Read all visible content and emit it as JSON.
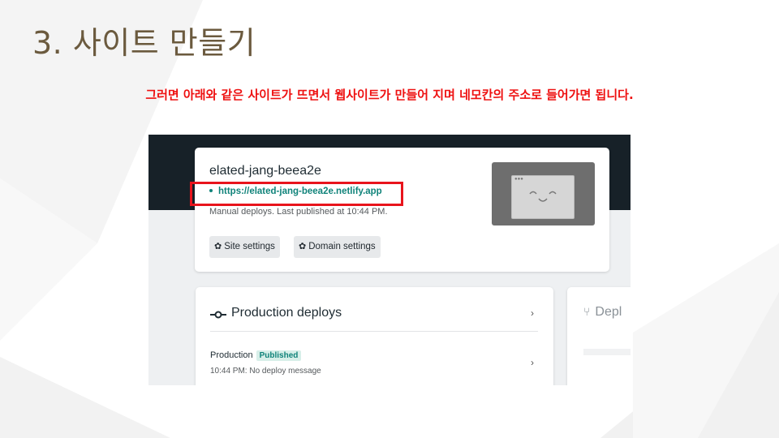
{
  "slide": {
    "title": "3. 사이트 만들기",
    "subtitle": "그러면 아래와 같은 사이트가 뜨면서 웹사이트가 만들어 지며 네모칸의 주소로 들어가면 됩니다."
  },
  "netlify": {
    "site_name": "elated-jang-beea2e",
    "site_url": "https://elated-jang-beea2e.netlify.app",
    "site_meta": "Manual deploys. Last published at 10:44 PM.",
    "site_settings_label": "Site settings",
    "domain_settings_label": "Domain settings",
    "settings_icon": "gear-icon",
    "thumbnail_icon": "smiley-browser-icon",
    "production_deploys_title": "Production deploys",
    "production_label": "Production",
    "published_badge": "Published",
    "production_meta": "10:44 PM: No deploy message",
    "deploy_preview_title": "Depl"
  },
  "colors": {
    "title": "#6b5a3e",
    "subtitle": "#ee1111",
    "header_dark": "#172128",
    "link_teal": "#10837a",
    "highlight_box": "#e8141c"
  }
}
